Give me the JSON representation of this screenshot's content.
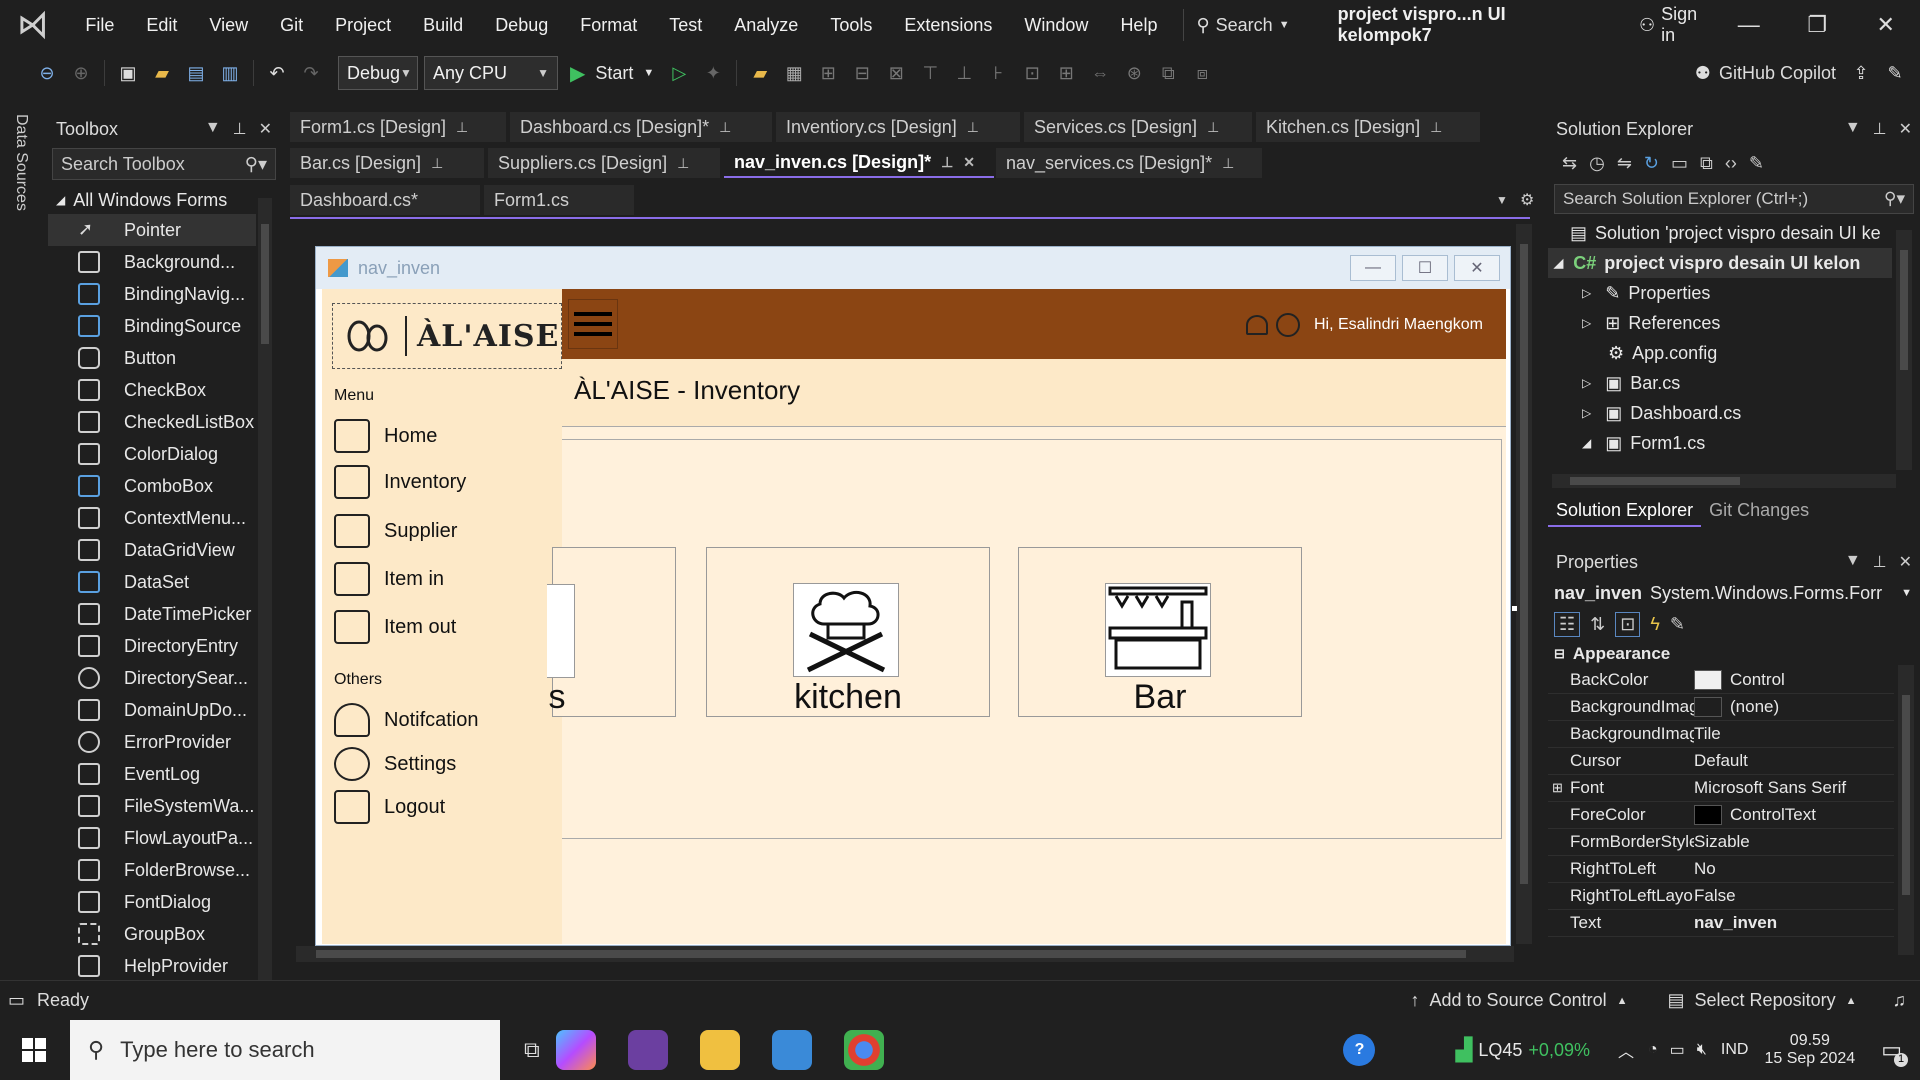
{
  "menubar": {
    "items": [
      "File",
      "Edit",
      "View",
      "Git",
      "Project",
      "Build",
      "Debug",
      "Format",
      "Test",
      "Analyze",
      "Tools",
      "Extensions",
      "Window",
      "Help"
    ],
    "search_label": "Search",
    "solution_name": "project vispro...n UI kelompok7",
    "signin_label": "Sign in"
  },
  "toolbar": {
    "config": "Debug",
    "platform": "Any CPU",
    "start_label": "Start",
    "copilot_label": "GitHub Copilot"
  },
  "sidestrip": {
    "label": "Data Sources"
  },
  "toolbox": {
    "title": "Toolbox",
    "search_placeholder": "Search Toolbox",
    "group": "All Windows Forms",
    "items": [
      "Pointer",
      "Background...",
      "BindingNavig...",
      "BindingSource",
      "Button",
      "CheckBox",
      "CheckedListBox",
      "ColorDialog",
      "ComboBox",
      "ContextMenu...",
      "DataGridView",
      "DataSet",
      "DateTimePicker",
      "DirectoryEntry",
      "DirectorySear...",
      "DomainUpDo...",
      "ErrorProvider",
      "EventLog",
      "FileSystemWa...",
      "FlowLayoutPa...",
      "FolderBrowse...",
      "FontDialog",
      "GroupBox",
      "HelpProvider"
    ]
  },
  "tabs": {
    "row1": [
      "Form1.cs [Design]",
      "Dashboard.cs [Design]*",
      "Inventiory.cs [Design]",
      "Services.cs [Design]",
      "Kitchen.cs [Design]"
    ],
    "row2": [
      "Bar.cs [Design]",
      "Suppliers.cs [Design]",
      "nav_inven.cs [Design]*",
      "nav_services.cs [Design]*"
    ],
    "row3": [
      "Dashboard.cs*",
      "Form1.cs"
    ]
  },
  "form": {
    "title": "nav_inven",
    "brand": "ÀL'AISE",
    "greeting": "Hi, Esalindri Maengkom",
    "page_title": "ÀL'AISE - Inventory",
    "menu_header": "Menu",
    "menu_items": [
      "Home",
      "Inventory",
      "Supplier",
      "Item in",
      "Item out"
    ],
    "others_header": "Others",
    "others_items": [
      "Notifcation",
      "Settings",
      "Logout"
    ],
    "cards": [
      "s",
      "kitchen",
      "Bar"
    ]
  },
  "solution_explorer": {
    "title": "Solution Explorer",
    "search_placeholder": "Search Solution Explorer (Ctrl+;)",
    "rows": [
      "Solution 'project vispro desain UI ke",
      "project vispro desain UI kelon",
      "Properties",
      "References",
      "App.config",
      "Bar.cs",
      "Dashboard.cs",
      "Form1.cs"
    ],
    "bottom_tabs": [
      "Solution Explorer",
      "Git Changes"
    ]
  },
  "properties": {
    "title": "Properties",
    "object": "nav_inven",
    "object_type": "System.Windows.Forms.Forr",
    "category": "Appearance",
    "rows": [
      {
        "name": "BackColor",
        "value": "Control",
        "swatch": "#f0f0f0"
      },
      {
        "name": "BackgroundImage",
        "value": "(none)",
        "swatch": "#1f1f1f"
      },
      {
        "name": "BackgroundImage",
        "value": "Tile"
      },
      {
        "name": "Cursor",
        "value": "Default"
      },
      {
        "name": "Font",
        "value": "Microsoft Sans Serif"
      },
      {
        "name": "ForeColor",
        "value": "ControlText",
        "swatch": "#000000"
      },
      {
        "name": "FormBorderStyle",
        "value": "Sizable"
      },
      {
        "name": "RightToLeft",
        "value": "No"
      },
      {
        "name": "RightToLeftLayout",
        "value": "False"
      },
      {
        "name": "Text",
        "value": "nav_inven"
      }
    ]
  },
  "statusbar": {
    "status": "Ready",
    "source_control": "Add to Source Control",
    "repo": "Select Repository"
  },
  "taskbar": {
    "search_placeholder": "Type here to search",
    "stock": "LQ45",
    "stock_change": "+0,09%",
    "lang": "IND",
    "time": "09.59",
    "date": "15 Sep 2024",
    "notif_count": "1"
  },
  "colors": {
    "accent": "#8a6de8",
    "app_header": "#8b4513",
    "app_side": "#fde9c8"
  }
}
